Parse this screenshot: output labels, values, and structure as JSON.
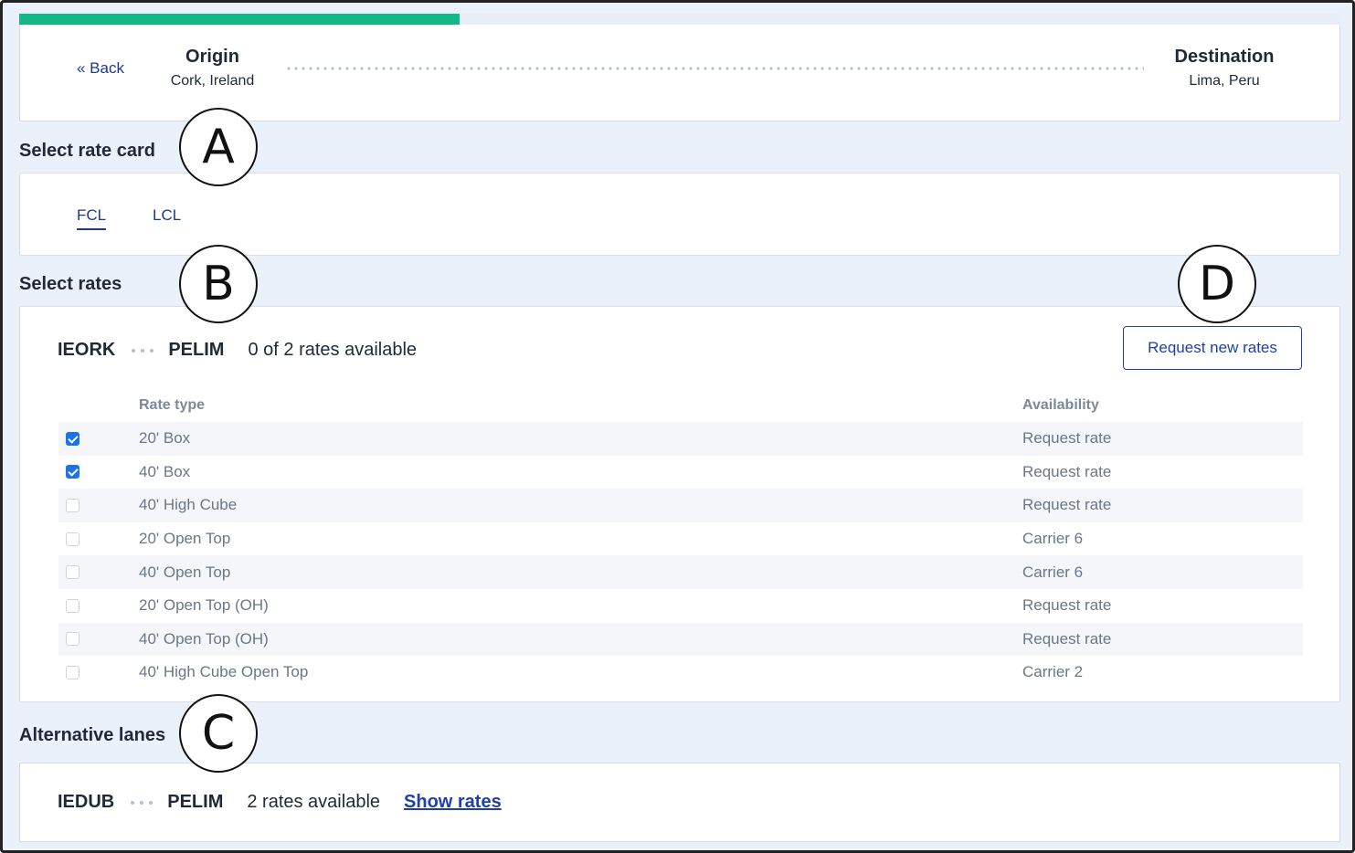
{
  "progress": {
    "fraction": 0.333
  },
  "route": {
    "back_label": "« Back",
    "origin_title": "Origin",
    "origin_place": "Cork, Ireland",
    "destination_title": "Destination",
    "destination_place": "Lima, Peru"
  },
  "rate_card": {
    "heading": "Select rate card",
    "tabs": [
      {
        "label": "FCL",
        "active": true
      },
      {
        "label": "LCL",
        "active": false
      }
    ]
  },
  "rates": {
    "heading": "Select rates",
    "origin_code": "IEORK",
    "destination_code": "PELIM",
    "available_text": "0 of 2 rates available",
    "request_button": "Request new rates",
    "columns": {
      "rate_type": "Rate type",
      "availability": "Availability"
    },
    "rows": [
      {
        "rate_type": "20' Box",
        "availability": "Request rate",
        "checked": true
      },
      {
        "rate_type": "40' Box",
        "availability": "Request rate",
        "checked": true
      },
      {
        "rate_type": "40' High Cube",
        "availability": "Request rate",
        "checked": false
      },
      {
        "rate_type": "20' Open Top",
        "availability": "Carrier 6",
        "checked": false
      },
      {
        "rate_type": "40' Open Top",
        "availability": "Carrier 6",
        "checked": false
      },
      {
        "rate_type": "20' Open Top (OH)",
        "availability": "Request rate",
        "checked": false
      },
      {
        "rate_type": "40' Open Top (OH)",
        "availability": "Request rate",
        "checked": false
      },
      {
        "rate_type": "40' High Cube Open Top",
        "availability": "Carrier 2",
        "checked": false
      }
    ]
  },
  "alternative": {
    "heading": "Alternative lanes",
    "origin_code": "IEDUB",
    "destination_code": "PELIM",
    "available_text": "2 rates available",
    "show_link": "Show rates"
  },
  "callouts": {
    "a": "A",
    "b": "B",
    "c": "C",
    "d": "D"
  },
  "colors": {
    "accent": "#12b886",
    "link": "#1e40af",
    "checkbox": "#1a73e8",
    "background": "#eaf1fb"
  }
}
